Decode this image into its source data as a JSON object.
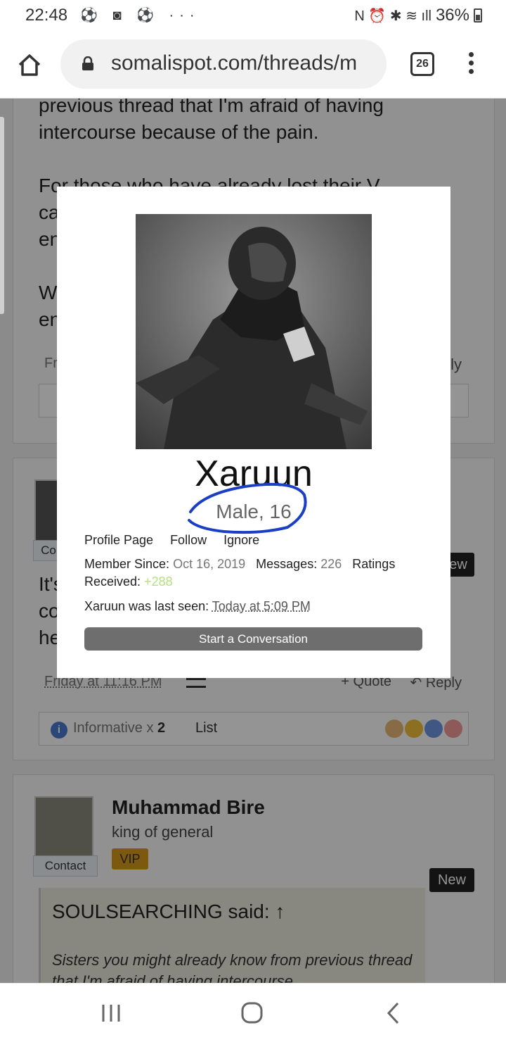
{
  "status_bar": {
    "time": "22:48",
    "notification_icons": "⚽ ◙ ⚽ ···",
    "system_icons": "N ⏰ ✱ ≋ ıll",
    "battery": "36%"
  },
  "browser": {
    "url": "somalispot.com/threads/m",
    "tab_count": "26",
    "icons": [
      "home-icon",
      "lock-icon",
      "tab-switcher-icon",
      "more-menu-icon"
    ]
  },
  "background": {
    "post1": {
      "text_lines": [
        "previous thread that I'm afraid of having",
        "intercourse because of the pain.",
        "",
        "For those who have already lost their V",
        "ca",
        "en",
        "",
        "W",
        "en"
      ],
      "meta_left": "Fr",
      "meta_right": "ly"
    },
    "post2": {
      "contact_label": "Co",
      "new_badge": "ew",
      "text_lines": [
        "It's",
        "co",
        "he"
      ],
      "date": "Friday at 11:16 PM",
      "quote_label": "+ Quote",
      "reply_label": "Reply",
      "reaction_summary": "Informative x",
      "reaction_count": "2",
      "list_label": "List"
    },
    "post3": {
      "user_name": "Muhammad Bire",
      "user_title": "king of general",
      "vip_label": "VIP",
      "contact_label": "Contact",
      "new_badge": "New",
      "quote_head": "SOULSEARCHING said: ↑",
      "quote_body": "Sisters you might already know from previous thread that I'm afraid of having intercourse"
    }
  },
  "profile_card": {
    "name": "Xaruun",
    "subtitle": "Male, 16",
    "links": [
      "Profile Page",
      "Follow",
      "Ignore"
    ],
    "member_since_label": "Member Since:",
    "member_since_value": "Oct 16, 2019",
    "messages_label": "Messages:",
    "messages_value": "226",
    "ratings_label": "Ratings",
    "received_label": "Received:",
    "received_value": "+288",
    "last_seen_label": "Xaruun was last seen:",
    "last_seen_value": "Today at 5:09 PM",
    "conversation_button": "Start a Conversation"
  },
  "nav": {
    "icons": [
      "recent-apps-icon",
      "home-circle-icon",
      "back-icon"
    ]
  },
  "colors": {
    "overlay": "#000000",
    "circle_annotation": "#1a3fc4",
    "ratings_positive": "#b5e17a",
    "button": "#6e6e6e",
    "vip": "#d89a1c"
  }
}
